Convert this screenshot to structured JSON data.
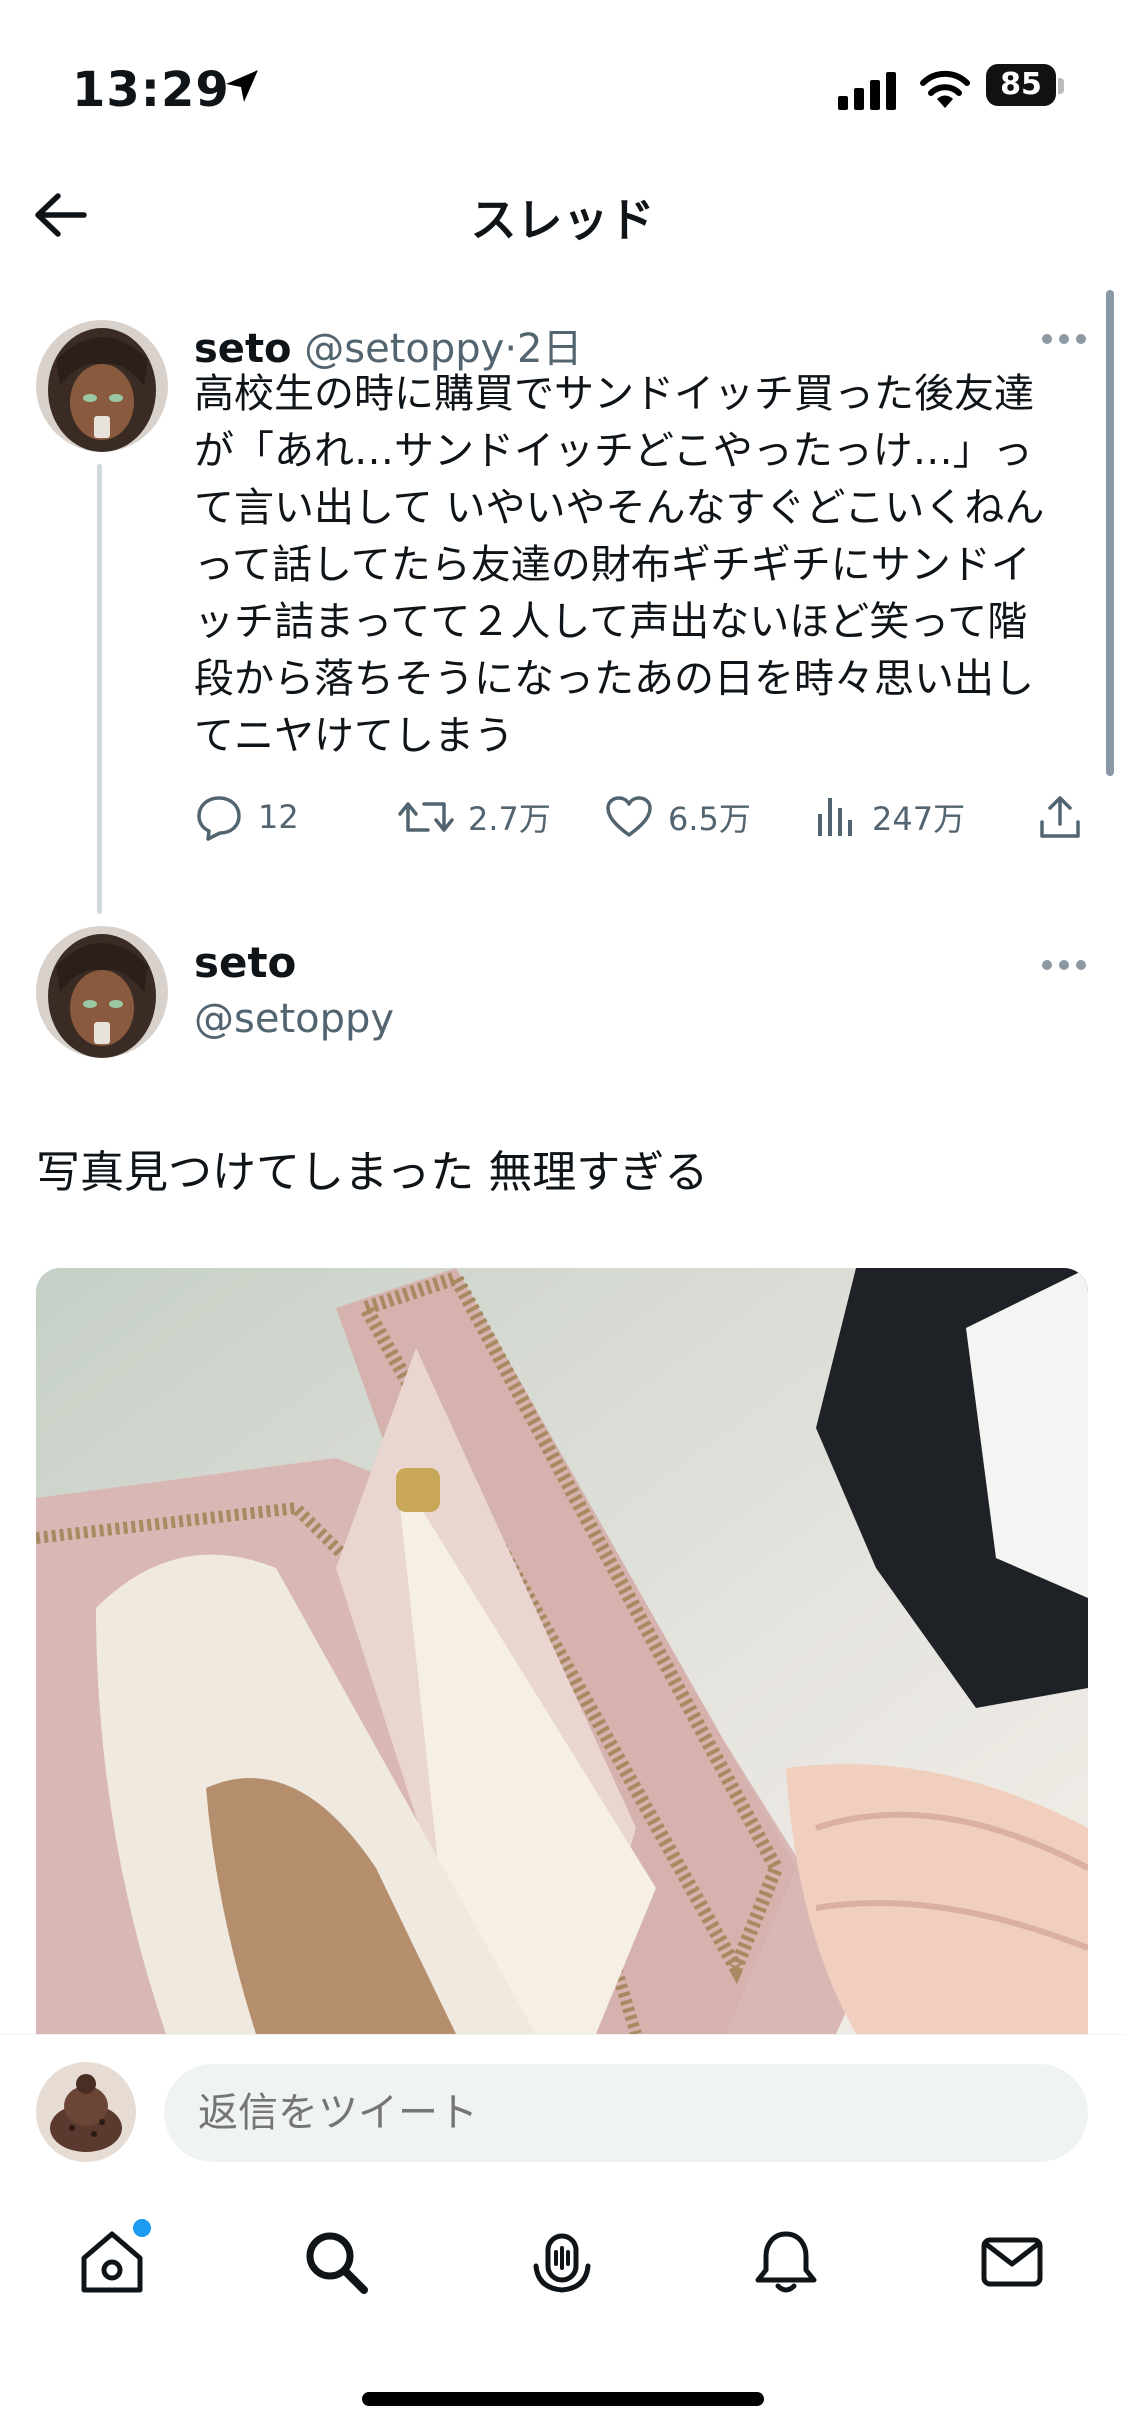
{
  "status_bar": {
    "time": "13:29",
    "battery_level": "85"
  },
  "header": {
    "title": "スレッド"
  },
  "first_tweet": {
    "name": "seto",
    "handle": "@setoppy",
    "separator": "·",
    "time": "2日",
    "text_lines": [
      "高校生の時に購買でサンドイッチ買った後友達",
      "が「あれ…サンドイッチどこやったっけ…」っ",
      "て言い出して いやいやそんなすぐどこいくねん",
      "って話してたら友達の財布ギチギチにサンドイ",
      "ッチ詰まってて２人して声出ないほど笑って階",
      "段から落ちそうになったあの日を時々思い出し",
      "てニヤけてしまう"
    ],
    "actions": {
      "replies": "12",
      "retweets": "2.7万",
      "likes": "6.5万",
      "views": "247万"
    }
  },
  "main_tweet": {
    "name": "seto",
    "handle": "@setoppy",
    "text": "写真見つけてしまった 無理すぎる"
  },
  "reply": {
    "placeholder": "返信をツイート"
  },
  "tabs": [
    "home-icon",
    "search-icon",
    "spaces-icon",
    "notifications-icon",
    "messages-icon"
  ],
  "colors": {
    "accent": "#1d9bf0",
    "secondary_text": "#536471",
    "primary_text": "#0f1419",
    "divider": "#eff3f4"
  }
}
